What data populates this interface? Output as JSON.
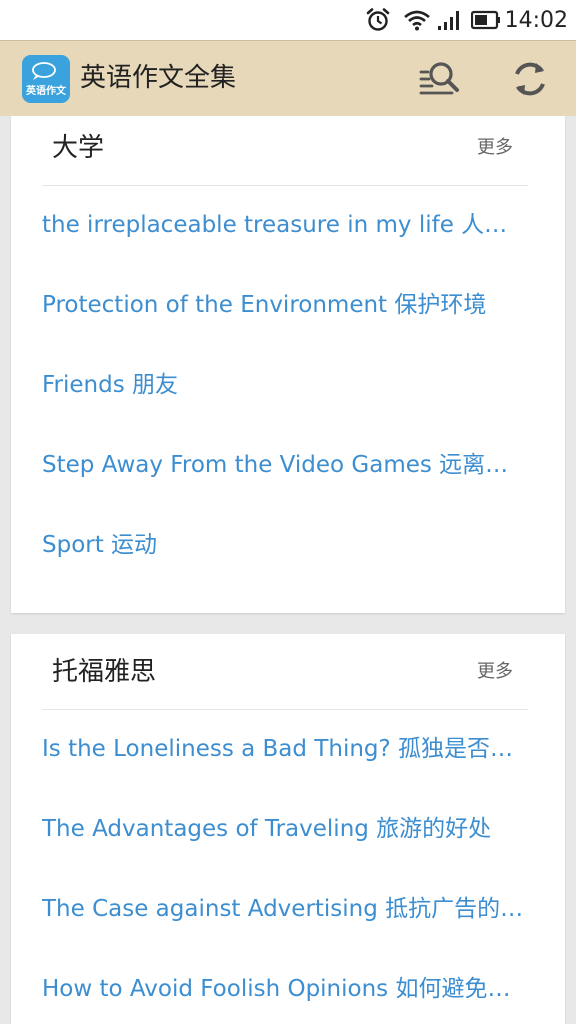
{
  "status_bar": {
    "time": "14:02",
    "icons": [
      "alarm-icon",
      "wifi-icon",
      "signal-icon",
      "battery-icon"
    ]
  },
  "app_bar": {
    "logo_text": "英语作文",
    "title": "英语作文全集",
    "actions": [
      "search-icon",
      "refresh-icon"
    ]
  },
  "sections": [
    {
      "title": "大学",
      "more_label": "更多",
      "articles": [
        "the irreplaceable treasure in my life 人生…",
        "Protection of the Environment 保护环境",
        "Friends 朋友",
        "Step Away From the Video Games 远离…",
        "Sport 运动"
      ]
    },
    {
      "title": "托福雅思",
      "more_label": "更多",
      "articles": [
        "Is the Loneliness a Bad Thing? 孤独是否…",
        "The Advantages of Traveling 旅游的好处",
        "The Case against Advertising 抵抗广告的…",
        "How to Avoid Foolish Opinions 如何避免…"
      ]
    }
  ],
  "colors": {
    "app_bar": "#e6d8b8",
    "link": "#3d8ed0",
    "logo_bg": "#3aa3dd",
    "background": "#e8e8e8"
  }
}
